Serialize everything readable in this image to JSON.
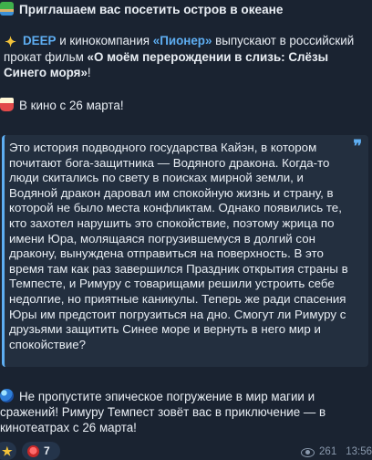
{
  "message": {
    "title_emoji": "island-emoji",
    "title": "Приглашаем вас посетить остров в океане",
    "para1": {
      "emoji": "sparkle-emoji",
      "brand1": "DEEP",
      "text1": " и кинокомпания ",
      "brand2": "«Пионер»",
      "text2": " выпускают в российский прокат фильм ",
      "film_title": "«О моём перерождении в слизь: Слёзы Синего моря»",
      "text3": "!"
    },
    "para2": {
      "emoji": "popcorn-emoji",
      "text": "В кино с 26 марта!"
    },
    "quote": {
      "icon": "quote-icon",
      "text": "Это история подводного государства Кайэн, в котором почитают бога-защитника — Водяного дракона. Когда-то люди скитались по свету в поисках мирной земли, и Водяной дракон даровал им спокойную жизнь и страну, в которой не было места конфликтам. Однако появились те, кто захотел нарушить это спокойствие, поэтому жрица по имени Юра, молящаяся погрузившемуся в долгий сон дракону, вынуждена отправиться на поверхность. В это время там как раз завершился Праздник открытия страны в Темпесте, и Римуру с товарищами решили устроить себе недолгие, но приятные каникулы. Теперь же ради спасения Юры им предстоит погрузиться на дно. Смогут ли Римуру с друзьями защитить Синее море и вернуть в него мир и спокойствие?"
    },
    "para3": {
      "emoji": "wave-emoji",
      "text": "Не пропустите эпическое погружение в мир магии и сражений! Римуру Темпест зовёт вас в приключение — в кинотеатрах с 26 марта!"
    }
  },
  "footer": {
    "reactions": [
      {
        "icon": "star-icon",
        "count": ""
      },
      {
        "icon": "heart-icon",
        "count": "7"
      }
    ],
    "views": "261",
    "time": "13:56"
  },
  "colors": {
    "background": "#1a2331",
    "link": "#5eaef2",
    "quote_bg": "#232f3f",
    "meta": "#8a99ad"
  }
}
